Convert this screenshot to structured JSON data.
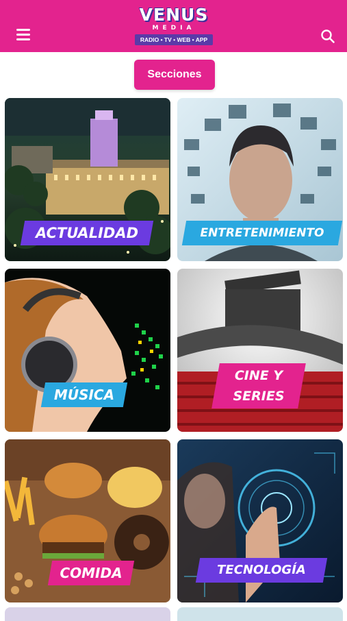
{
  "header": {
    "logo_title": "VENUS",
    "logo_subtitle": "MEDIA",
    "logo_tagline": "RADIO • TV • WEB • APP",
    "brand_color": "#e3238e",
    "menu_icon": "hamburger-menu-icon",
    "search_icon": "search-icon"
  },
  "sections_button": {
    "label": "Secciones"
  },
  "cards": [
    {
      "label": "ACTUALIDAD",
      "label_color": "#6b3be0"
    },
    {
      "label": "ENTRETENIMIENTO",
      "label_color": "#2aa8e0"
    },
    {
      "label": "MÚSICA",
      "label_color": "#2aa8e0"
    },
    {
      "label_line1": "CINE Y",
      "label_line2": "SERIES",
      "label_color": "#e3238e"
    },
    {
      "label": "COMIDA",
      "label_color": "#e3238e"
    },
    {
      "label": "TECNOLOGÍA",
      "label_color": "#6b3be0"
    }
  ]
}
